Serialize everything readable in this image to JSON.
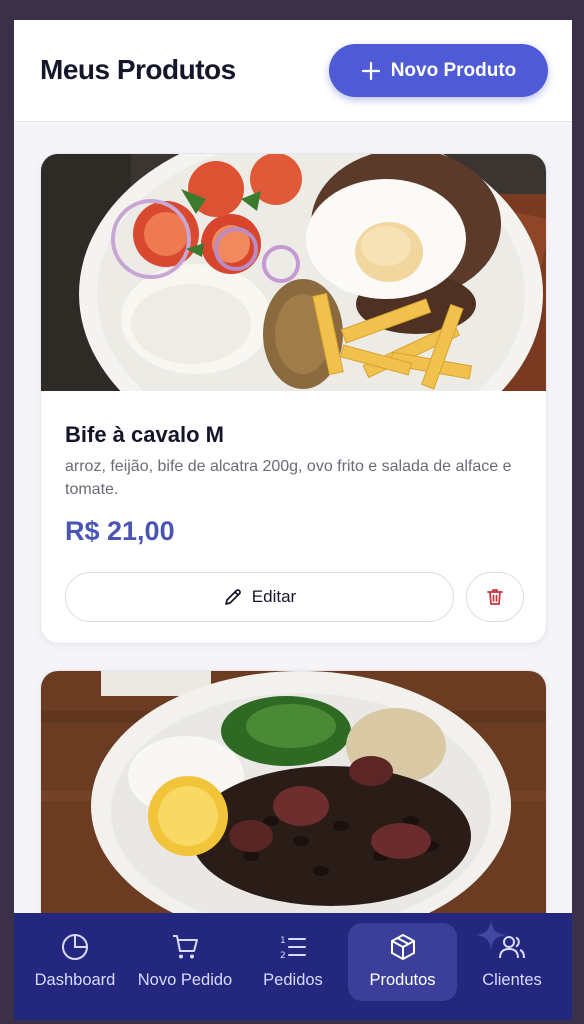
{
  "header": {
    "title": "Meus Produtos",
    "new_product_label": "Novo Produto"
  },
  "products": [
    {
      "name": "Bife à cavalo M",
      "description": "arroz, feijão, bife de alcatra 200g, ovo frito e salada de alface e tomate.",
      "price": "R$ 21,00",
      "edit_label": "Editar"
    },
    {
      "name": "",
      "description": "",
      "price": "",
      "edit_label": ""
    }
  ],
  "bottom_nav": {
    "items": [
      {
        "label": "Dashboard",
        "icon": "pie-chart-icon"
      },
      {
        "label": "Novo Pedido",
        "icon": "shopping-cart-icon"
      },
      {
        "label": "Pedidos",
        "icon": "ordered-list-icon"
      },
      {
        "label": "Produtos",
        "icon": "package-box-icon",
        "active": true
      },
      {
        "label": "Clientes",
        "icon": "users-icon"
      }
    ]
  },
  "colors": {
    "accent": "#4f5ad6",
    "price": "#4a54b3",
    "nav_background": "#23277e",
    "delete": "#c8323a"
  }
}
